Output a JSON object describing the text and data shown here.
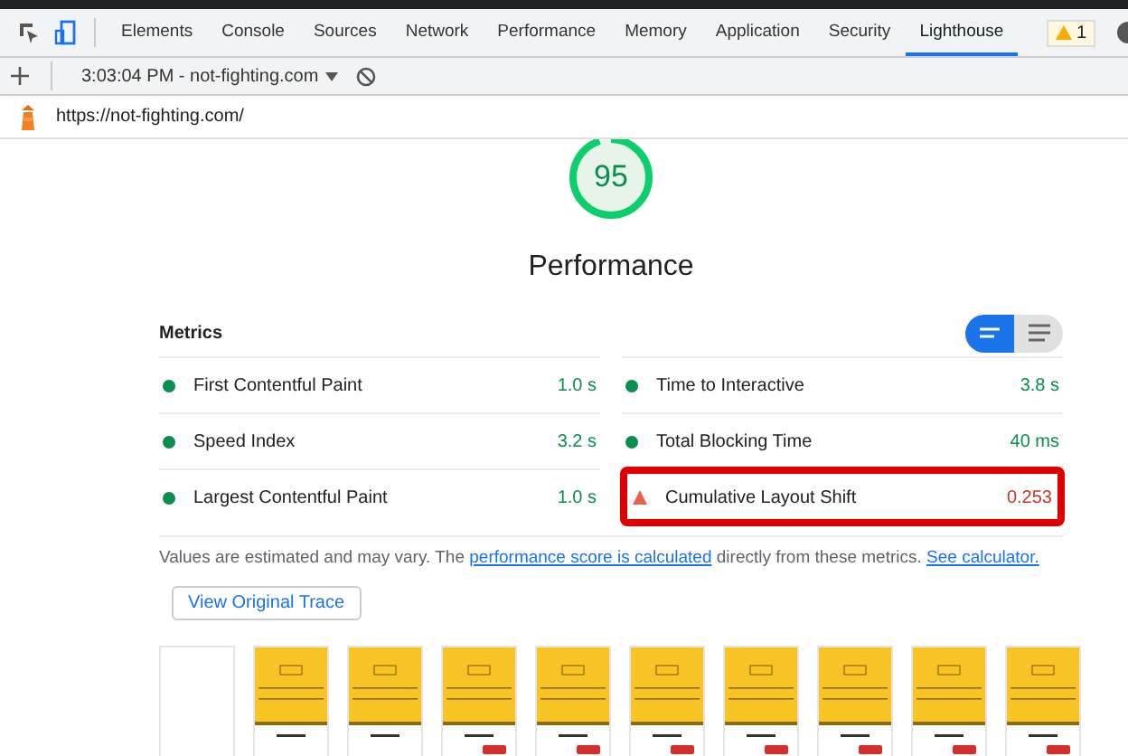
{
  "tabs": [
    {
      "label": "Elements",
      "selected": false
    },
    {
      "label": "Console",
      "selected": false
    },
    {
      "label": "Sources",
      "selected": false
    },
    {
      "label": "Network",
      "selected": false
    },
    {
      "label": "Performance",
      "selected": false
    },
    {
      "label": "Memory",
      "selected": false
    },
    {
      "label": "Application",
      "selected": false
    },
    {
      "label": "Security",
      "selected": false
    },
    {
      "label": "Lighthouse",
      "selected": true
    }
  ],
  "warning_badge": {
    "count": "1"
  },
  "report_selector": {
    "value": "3:03:04 PM - not-fighting.com"
  },
  "url": "https://not-fighting.com/",
  "score": {
    "value": "95",
    "level": 0.95,
    "title": "Performance"
  },
  "metrics": {
    "title": "Metrics",
    "view_toggle": [
      {
        "kind": "compact",
        "selected": true
      },
      {
        "kind": "expanded",
        "selected": false
      }
    ],
    "items": [
      {
        "name": "First Contentful Paint",
        "value": "1.0 s",
        "kind": "pass",
        "highlighted": false
      },
      {
        "name": "Time to Interactive",
        "value": "3.8 s",
        "kind": "pass",
        "highlighted": false
      },
      {
        "name": "Speed Index",
        "value": "3.2 s",
        "kind": "pass",
        "highlighted": false
      },
      {
        "name": "Total Blocking Time",
        "value": "40 ms",
        "kind": "pass",
        "highlighted": false
      },
      {
        "name": "Largest Contentful Paint",
        "value": "1.0 s",
        "kind": "pass",
        "highlighted": false
      },
      {
        "name": "Cumulative Layout Shift",
        "value": "0.253",
        "kind": "fail",
        "highlighted": true
      }
    ],
    "note": [
      {
        "text": "Values are estimated and may vary. The ",
        "kind": "plain"
      },
      {
        "text": "performance score is calculated",
        "kind": "link"
      },
      {
        "text": " directly from these metrics. ",
        "kind": "plain"
      },
      {
        "text": "See calculator.",
        "kind": "link"
      }
    ]
  },
  "trace_button": "View Original Trace",
  "filmstrip": [
    {
      "kind": "blank"
    },
    {
      "kind": "header"
    },
    {
      "kind": "header"
    },
    {
      "kind": "full"
    },
    {
      "kind": "full"
    },
    {
      "kind": "full"
    },
    {
      "kind": "full"
    },
    {
      "kind": "full"
    },
    {
      "kind": "full"
    },
    {
      "kind": "full"
    }
  ]
}
